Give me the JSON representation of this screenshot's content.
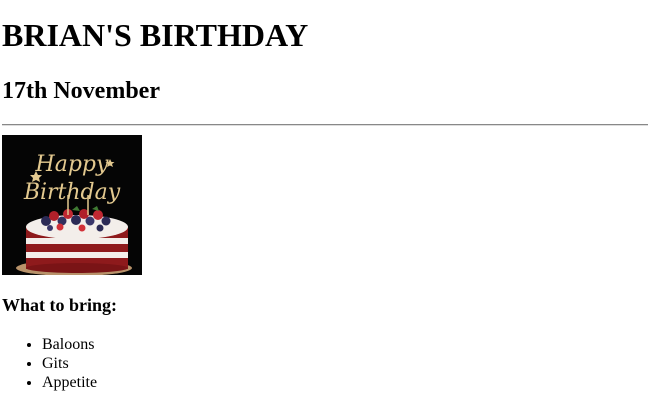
{
  "page": {
    "title": "BRIAN'S BIRTHDAY",
    "date": "17th November",
    "image": {
      "text_top": "Happy",
      "text_bottom": "Birthday"
    },
    "bring_heading": "What to bring:",
    "bring_items": [
      "Baloons",
      "Gits",
      "Appetite"
    ]
  },
  "colors": {
    "image_background": "#050505",
    "topper_gold": "#e3c98f",
    "cake_red": "#8e1a1c",
    "frosting": "#f3eeea"
  }
}
